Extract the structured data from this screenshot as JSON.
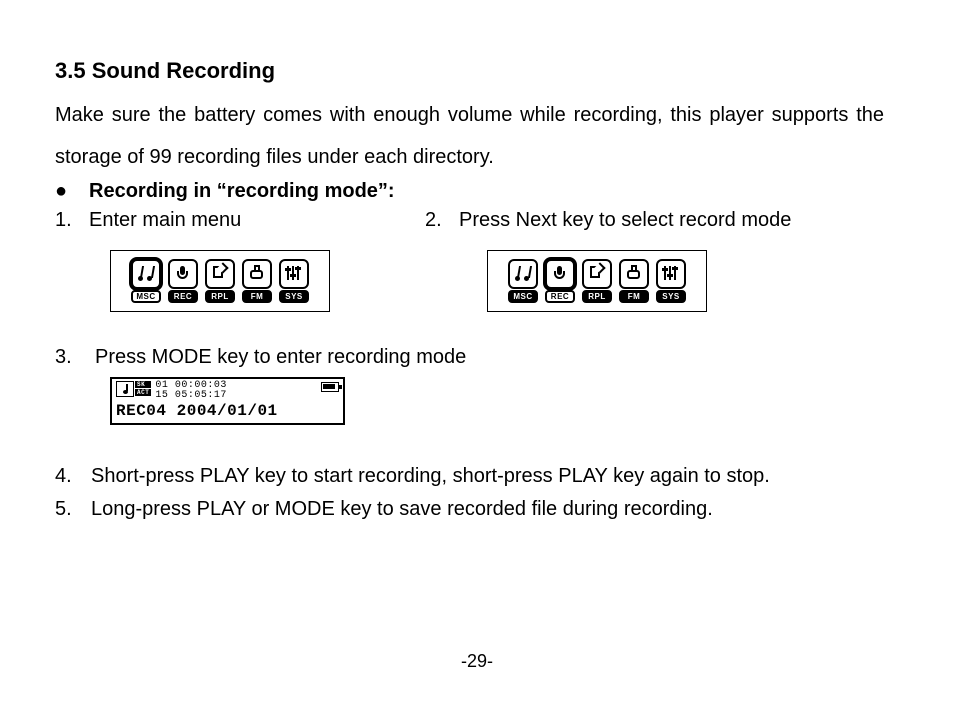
{
  "section": {
    "number": "3.5",
    "title": "Sound Recording"
  },
  "intro": "Make sure the battery comes with enough volume while recording, this player supports the storage of 99 recording files under each directory.",
  "bullet_heading": "Recording in “recording mode”:",
  "menu_labels": {
    "msc": "MSC",
    "rec": "REC",
    "rpl": "RPL",
    "fm": "FM",
    "sys": "SYS"
  },
  "steps": {
    "s1": {
      "num": "1.",
      "text": "Enter main menu"
    },
    "s2": {
      "num": "2.",
      "text": "Press Next key to select record mode"
    },
    "s3": {
      "num": "3.",
      "text": "Press MODE key to enter recording mode"
    },
    "s4": {
      "num": "4.",
      "text": "Short-press PLAY key to start recording, short-press PLAY key again to stop."
    },
    "s5": {
      "num": "5.",
      "text": "Long-press PLAY or MODE key to save recorded file during recording."
    }
  },
  "record_screen": {
    "badge_top": "SK",
    "badge_bottom": "ACT",
    "line1": "01 00:00:03",
    "line2": "15 05:05:17",
    "filename": "REC04",
    "date": "2004/01/01"
  },
  "page_number": "-29-"
}
